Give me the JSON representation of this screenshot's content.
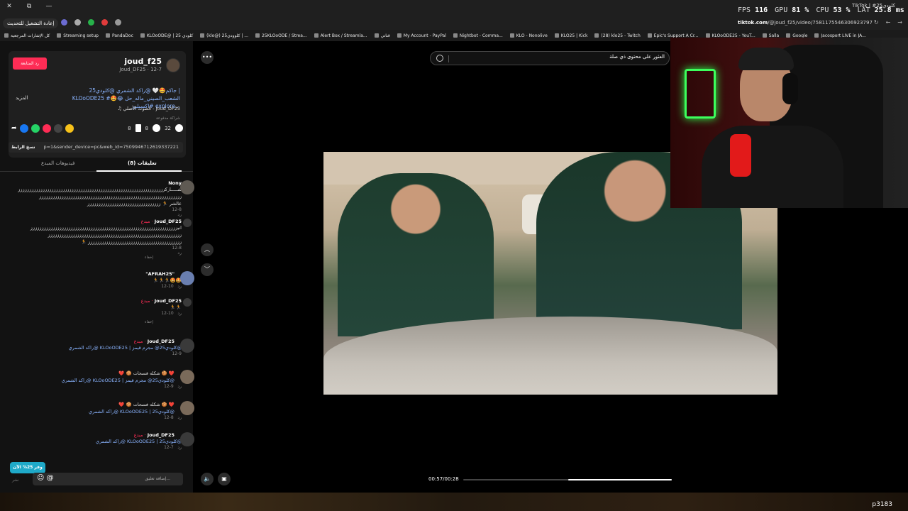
{
  "titlebar": {
    "stats": [
      {
        "label": "FPS",
        "value": "116"
      },
      {
        "label": "GPU",
        "value": "81 %"
      },
      {
        "label": "CPU",
        "value": "53 %"
      },
      {
        "label": "LAT",
        "value": "25.8 ms"
      }
    ],
    "tab_title": "TikTok | #كلودي25"
  },
  "browser": {
    "reload_label": "إعادة التشغيل للتحديث",
    "url_domain": "tiktok.com",
    "url_path": "/@joud_f25/video/7581175546306923797"
  },
  "bookmarks": [
    "كل الإشارات المرجعية",
    "Streaming setup",
    "PandaDoc",
    "KLOoODE@ | كلودي 25",
    "(klo@) كلوودي25 | ...",
    "25KLOoODE / Strea...",
    "Alert Box / Streamla...",
    "قناتي",
    "My Account - PayPal",
    "Nightbot - Comma...",
    "KLO - Nonolive",
    "KLO25 | Kick",
    "(28) klo25 - Twitch",
    "Epic's Support A Cr...",
    "KLOoODE25 - YouT...",
    "Salla",
    "Google",
    "Jacosport LIVE in JA..."
  ],
  "post": {
    "follow_label": "رد المتابعة",
    "username": "joud_f25",
    "handle_date": "Joud_DF25 · 12-7",
    "more_label": "المزيد",
    "caption": "جاكم🤩🤍 @راكد الشمري @كلودي25 | KLOoODE25 #الشعب_الصيني_ماله_حل 😂🤩 #اكسبلور explore...",
    "sound": "♫ الصوت الأصلي - Joud_DF25",
    "partnership": "شراكة مدفوعة",
    "stats": {
      "likes": "32",
      "comments": "8",
      "saves": "8"
    },
    "copy_link_label": "نسخ الرابط",
    "link_text": "p=1&sender_device=pc&web_id=7509946712619337221",
    "tabs": {
      "comments": "تعليقات (8)",
      "creator_videos": "فيديوهات المبدع"
    }
  },
  "comments": [
    {
      "name": "Nony",
      "creator": "",
      "text": "شـــــاركزززززززززززززززززززززززززززززززززززززززززززززززززززززززززززززززززز",
      "text2": "زززززززززززززززززززززززززززززززززززززززززززززززززززززززززززززززز",
      "text3": "عالشر 🏃 ززززززززززززززززززززززززززززززززز",
      "date": "12-8",
      "likes": "1"
    },
    {
      "name": "Joud_DF25",
      "creator": "مبدع · ",
      "text": "انيزززززززززززززززززززززززززززززززززززززززززززززززززززززززززززززززززز",
      "text2": "زززززززززززززززززززززززززززززززززززززززززززززززززززززززززززز",
      "text3": "🏃 زززززززززززززززززززززززززززززززززززززززززز",
      "date": "12-8",
      "likes": "0",
      "hide": "إخفاء"
    },
    {
      "name": "\"AFRAH25\"",
      "creator": "",
      "text": "🏃🏃🏃🤩🤩",
      "date": "12-10",
      "likes": "1"
    },
    {
      "name": "Joud_DF25",
      "creator": "مبدع · ",
      "text": "🏃🏃",
      "date": "12-10",
      "likes": "1",
      "hide": "إخفاء"
    },
    {
      "name": "Joud_DF25",
      "creator": "مبدع · ",
      "text": "راكد الشمري@ KLOoODE25 | كلودي25@ مجرم قيمز@",
      "date": "12-9",
      "likes": "1"
    },
    {
      "name": "",
      "creator": "",
      "text": "❤️ 🍪 شكله فسحات 🍪 ❤️",
      "text2": "راكد الشمري@ KLOoODE25 | كلودي25@ مجرم قيمز@",
      "date": "12-9",
      "likes": "1"
    },
    {
      "name": "",
      "creator": "",
      "text": "❤️ 🍪 شكله فسحات 🍪 ❤️",
      "text2": "راكد الشمري@ KLOoODE25 | كلودي25@",
      "date": "12-8",
      "likes": "1"
    },
    {
      "name": "Joud_DF25",
      "creator": "مبدع · ",
      "text": "راكد الشمري@ KLOoODE25 | كلودي25@",
      "date": "12-7",
      "likes": "0"
    }
  ],
  "reply_label": "رد",
  "promo_label": "وفر 25% الآن",
  "comment_box": {
    "placeholder": "إضافة تعليق...",
    "post_label": "نشر"
  },
  "search": {
    "placeholder": "العثور على محتوى ذي صلة"
  },
  "player": {
    "time": "00:57/00:28",
    "progress": 0.5
  },
  "overlay_code": "p3183",
  "colors": {
    "accent": "#fe2c55",
    "link": "#8ab4ff",
    "promo": "#1fa9c8"
  }
}
